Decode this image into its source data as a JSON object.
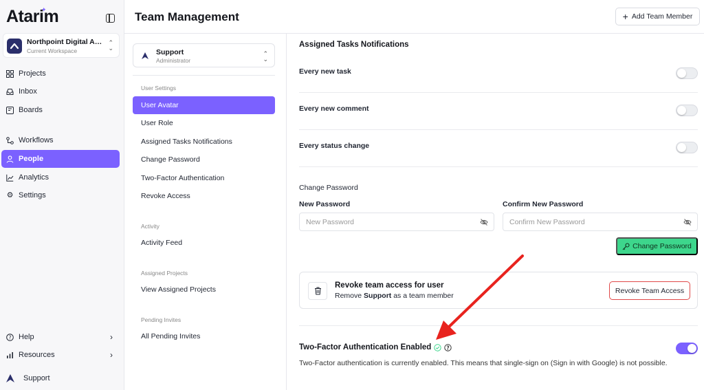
{
  "app": {
    "logo_text": "Atarim",
    "workspace_name": "Northpoint Digital Ag...",
    "workspace_sub": "Current Workspace"
  },
  "sidebar": {
    "items": [
      {
        "label": "Projects",
        "icon": "grid-icon"
      },
      {
        "label": "Inbox",
        "icon": "inbox-icon"
      },
      {
        "label": "Boards",
        "icon": "board-icon"
      },
      {
        "label": "Workflows",
        "icon": "workflow-icon"
      },
      {
        "label": "People",
        "icon": "person-icon",
        "active": true
      },
      {
        "label": "Analytics",
        "icon": "chart-icon"
      },
      {
        "label": "Settings",
        "icon": "gear-icon"
      }
    ],
    "bottom": [
      {
        "label": "Help",
        "icon": "help-icon"
      },
      {
        "label": "Resources",
        "icon": "bars-icon"
      }
    ],
    "user_label": "Support"
  },
  "header": {
    "title": "Team Management",
    "add_button": "Add Team Member"
  },
  "member": {
    "name": "Support",
    "role": "Administrator"
  },
  "settings_nav": {
    "groups": [
      {
        "title": "User Settings",
        "items": [
          "User Avatar",
          "User Role",
          "Assigned Tasks Notifications",
          "Change Password",
          "Two-Factor Authentication",
          "Revoke Access"
        ]
      },
      {
        "title": "Activity",
        "items": [
          "Activity Feed"
        ]
      },
      {
        "title": "Assigned Projects",
        "items": [
          "View Assigned Projects"
        ]
      },
      {
        "title": "Pending Invites",
        "items": [
          "All Pending Invites"
        ]
      }
    ],
    "active": "User Avatar"
  },
  "notifications": {
    "title": "Assigned Tasks Notifications",
    "rows": [
      {
        "label": "Every new task",
        "enabled": false
      },
      {
        "label": "Every new comment",
        "enabled": false
      },
      {
        "label": "Every status change",
        "enabled": false
      }
    ]
  },
  "password": {
    "title": "Change Password",
    "new_label": "New Password",
    "new_placeholder": "New Password",
    "confirm_label": "Confirm New Password",
    "confirm_placeholder": "Confirm New Password",
    "button": "Change Password"
  },
  "revoke": {
    "title": "Revoke team access for user",
    "sub_prefix": "Remove",
    "sub_name": "Support",
    "sub_suffix": "as a team member",
    "button": "Revoke Team Access"
  },
  "two_factor": {
    "title": "Two-Factor Authentication Enabled",
    "enabled": true,
    "description": "Two-Factor authentication is currently enabled. This means that single-sign on (Sign in with Google) is not possible."
  },
  "colors": {
    "accent": "#7b61ff",
    "success": "#3dd68c",
    "danger": "#e04848",
    "annotation_arrow": "#e8231e"
  }
}
